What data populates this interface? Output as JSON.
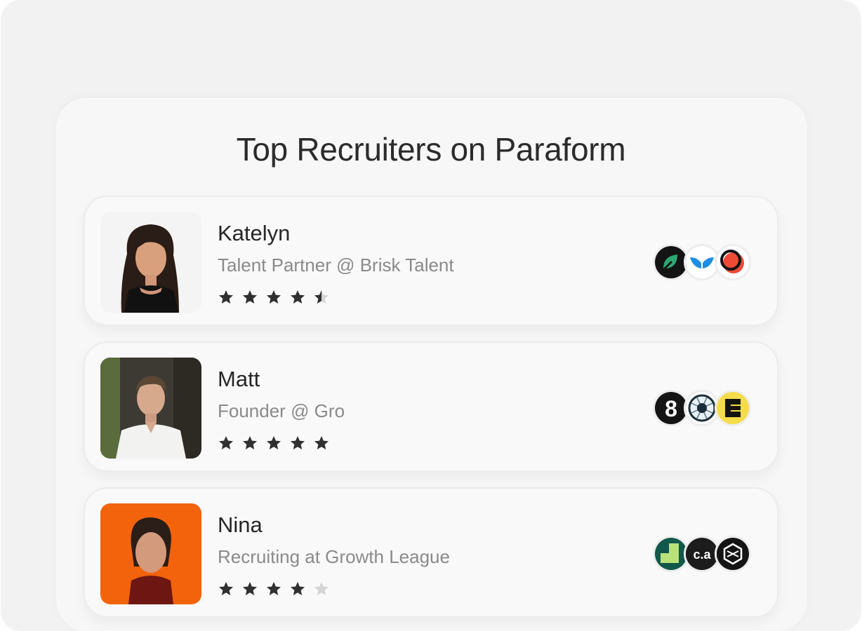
{
  "title": "Top Recruiters on Paraform",
  "recruiters": [
    {
      "name": "Katelyn",
      "role": "Talent Partner @ Brisk Talent",
      "rating": 4.5,
      "company_logos": [
        "green-leaf-logo",
        "blue-wings-logo",
        "red-circle-logo"
      ]
    },
    {
      "name": "Matt",
      "role": "Founder @ Gro",
      "rating": 5,
      "company_logos": [
        "eight-logo",
        "globe-grid-logo",
        "yellow-stack-logo"
      ]
    },
    {
      "name": "Nina",
      "role": "Recruiting at Growth League",
      "rating": 4,
      "company_logos": [
        "green-blocks-logo",
        "ca-text-logo",
        "dark-hexagon-logo"
      ]
    }
  ],
  "logo_text": {
    "eight": "8",
    "ca": "c.a"
  },
  "colors": {
    "star_filled": "#303030",
    "star_empty": "#d4d4d4",
    "title": "#2b2b2b",
    "role": "#8a8a8a"
  }
}
